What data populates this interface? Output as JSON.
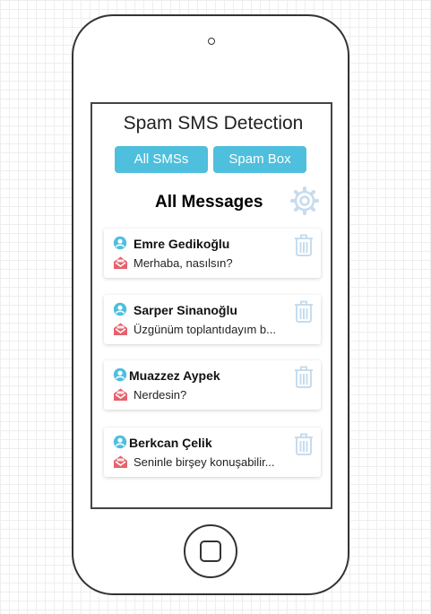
{
  "app": {
    "title": "Spam SMS Detection"
  },
  "tabs": [
    {
      "label": "All SMSs"
    },
    {
      "label": "Spam Box"
    }
  ],
  "section": {
    "title": "All Messages"
  },
  "messages": [
    {
      "sender": "Emre Gedikoğlu",
      "preview": "Merhaba, nasılsın?"
    },
    {
      "sender": "Sarper Sinanoğlu",
      "preview": "Üzgünüm toplantıdayım b..."
    },
    {
      "sender": "Muazzez Aypek",
      "preview": "Nerdesin?"
    },
    {
      "sender": "Berkcan Çelik",
      "preview": "Seninle birşey konuşabilir..."
    }
  ],
  "colors": {
    "accent": "#4ebfdc",
    "icon_light": "#c6dcee",
    "envelope": "#e5626d",
    "person": "#4ebfdc"
  },
  "icons": {
    "settings": "gear-icon",
    "sender": "person-icon",
    "message": "envelope-icon",
    "delete": "trash-icon"
  }
}
